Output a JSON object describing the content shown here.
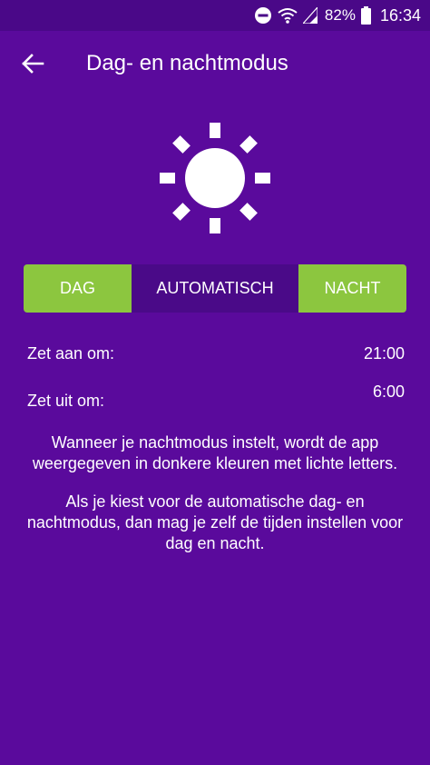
{
  "status_bar": {
    "battery": "82%",
    "time": "16:34",
    "icons": [
      "do-not-disturb-icon",
      "wifi-icon",
      "signal-icon",
      "battery-icon"
    ]
  },
  "header": {
    "title": "Dag- en nachtmodus",
    "back_icon": "arrow-left-icon"
  },
  "mode_icon": "sun-icon",
  "modes": {
    "dag": "DAG",
    "automatisch": "AUTOMATISCH",
    "nacht": "NACHT",
    "selected": "AUTOMATISCH"
  },
  "schedule": {
    "on_label": "Zet aan om:",
    "on_time": "21:00",
    "off_label": "Zet uit om:",
    "off_time": "6:00"
  },
  "info": {
    "p1": "Wanneer je nachtmodus instelt, wordt de app weergegeven in donkere kleuren met lichte letters.",
    "p2": "Als je kiest voor de automatische dag- en nachtmodus, dan mag je zelf de tijden instellen voor dag en nacht."
  },
  "colors": {
    "background": "#5a0a9c",
    "accent_green": "#8cc63f",
    "selected_segment": "#4a0a88"
  }
}
